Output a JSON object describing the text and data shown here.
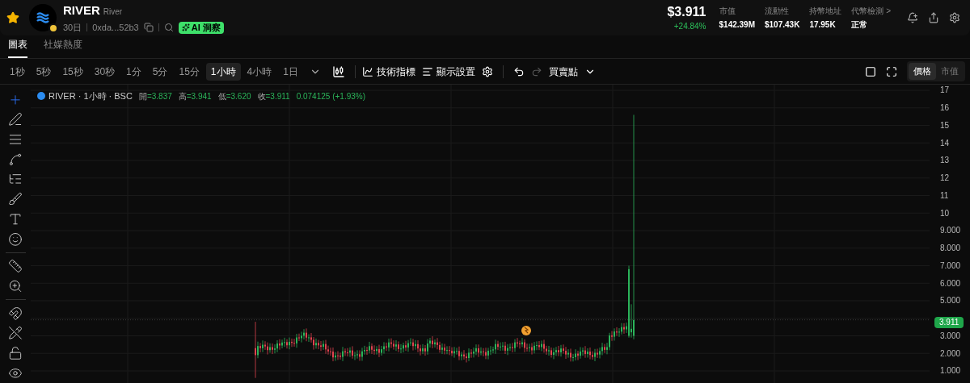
{
  "token": {
    "symbol": "RIVER",
    "name": "River",
    "age": "30日",
    "address": "0xda...52b3",
    "ai_badge": "AI 洞察"
  },
  "price": {
    "value": "$3.911",
    "change": "+24.84%"
  },
  "stats": [
    {
      "label": "市值",
      "value": "$142.39M"
    },
    {
      "label": "流動性",
      "value": "$107.43K"
    },
    {
      "label": "持幣地址",
      "value": "17.95K"
    },
    {
      "label": "代幣檢測 >",
      "value": "正常"
    }
  ],
  "tabs": [
    {
      "label": "圖表",
      "selected": true
    },
    {
      "label": "社媒熱度",
      "selected": false
    }
  ],
  "intervals": [
    {
      "label": "1秒",
      "selected": false
    },
    {
      "label": "5秒",
      "selected": false
    },
    {
      "label": "15秒",
      "selected": false
    },
    {
      "label": "30秒",
      "selected": false
    },
    {
      "label": "1分",
      "selected": false
    },
    {
      "label": "5分",
      "selected": false
    },
    {
      "label": "15分",
      "selected": false
    },
    {
      "label": "1小時",
      "selected": true
    },
    {
      "label": "4小時",
      "selected": false
    },
    {
      "label": "1日",
      "selected": false
    }
  ],
  "toolbar": {
    "indicators": "技術指標",
    "display": "顯示設置",
    "trades": "買賣點"
  },
  "scale_toggle": [
    {
      "label": "價格",
      "selected": true
    },
    {
      "label": "市值",
      "selected": false
    }
  ],
  "legend": {
    "title": "RIVER · 1小時 · BSC",
    "items": [
      {
        "label": "開",
        "value": "=3.837"
      },
      {
        "label": "高",
        "value": "=3.941"
      },
      {
        "label": "低",
        "value": "=3.620"
      },
      {
        "label": "收",
        "value": "=3.911"
      }
    ],
    "change": "0.074125 (+1.93%)"
  },
  "price_axis": [
    {
      "kind": "tick",
      "label": "17"
    },
    {
      "kind": "tick",
      "label": "16"
    },
    {
      "kind": "tick",
      "label": "15"
    },
    {
      "kind": "tick",
      "label": "14"
    },
    {
      "kind": "tick",
      "label": "13"
    },
    {
      "kind": "tick",
      "label": "12"
    },
    {
      "kind": "tick",
      "label": "11"
    },
    {
      "kind": "tick",
      "label": "10"
    },
    {
      "kind": "tick",
      "label": "9.000"
    },
    {
      "kind": "tick",
      "label": "8.000"
    },
    {
      "kind": "tick",
      "label": "7.000"
    },
    {
      "kind": "tick",
      "label": "6.000"
    },
    {
      "kind": "tick",
      "label": "5.000"
    },
    {
      "kind": "last",
      "label": "3.911"
    },
    {
      "kind": "tick",
      "label": "3.000"
    },
    {
      "kind": "tick",
      "label": "2.000"
    },
    {
      "kind": "tick",
      "label": "1.000"
    }
  ],
  "tool_groups": [
    [
      {
        "kind": "crosshair",
        "selected": true
      },
      {
        "kind": "line",
        "selected": false
      },
      {
        "kind": "channel",
        "selected": false
      },
      {
        "kind": "pattern",
        "selected": false
      },
      {
        "kind": "fib",
        "selected": false
      },
      {
        "kind": "brush",
        "selected": false
      },
      {
        "kind": "text",
        "selected": false
      },
      {
        "kind": "emoji",
        "selected": false
      }
    ],
    [
      {
        "kind": "ruler",
        "selected": false
      },
      {
        "kind": "zoom",
        "selected": false
      }
    ],
    [
      {
        "kind": "magnet",
        "selected": false
      },
      {
        "kind": "lockdraw",
        "selected": false
      },
      {
        "kind": "lock",
        "selected": false
      },
      {
        "kind": "eye",
        "selected": false
      }
    ]
  ]
}
